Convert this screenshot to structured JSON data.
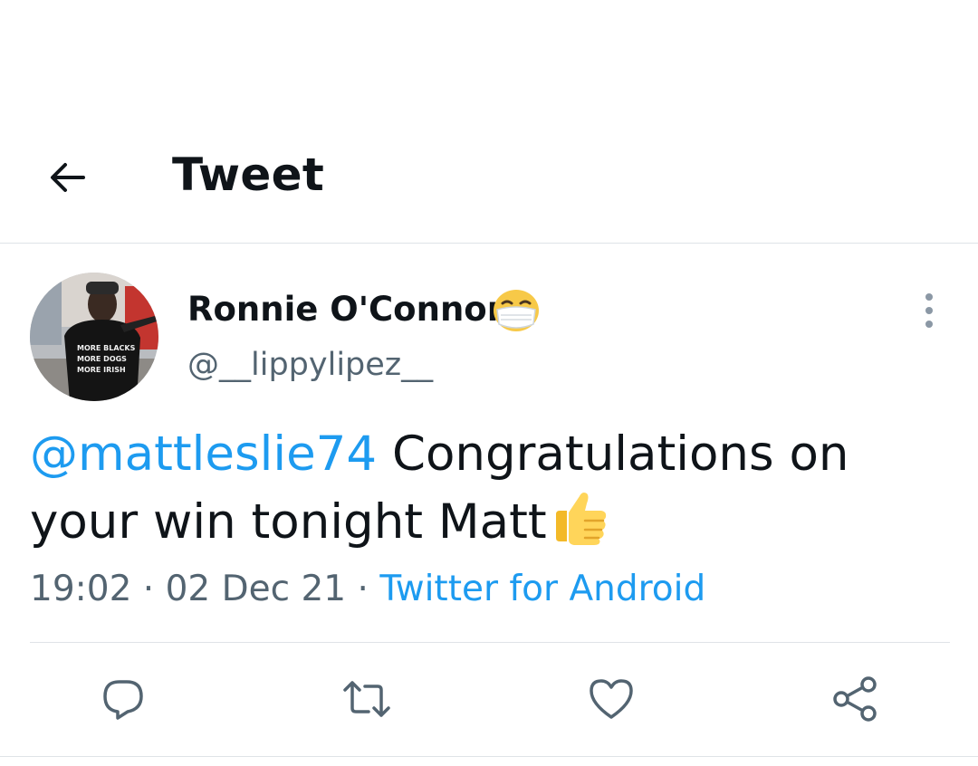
{
  "header": {
    "title": "Tweet",
    "back_icon": "arrow-left-icon"
  },
  "tweet": {
    "author": {
      "display_name": "Ronnie O'Connor",
      "name_emoji_icon": "face-with-medical-mask-icon",
      "handle": "@__lippylipez__",
      "avatar_icon": "user-avatar",
      "avatar_shirt_text": [
        "MORE BLACKS",
        "MORE DOGS",
        "MORE IRISH"
      ]
    },
    "mention": "@mattleslie74",
    "text_line1": " Congratulations on",
    "text_line2": "your win tonight Matt",
    "text_emoji_icon": "thumbs-up-icon",
    "time": "19:02",
    "separator": " · ",
    "date": "02 Dec 21",
    "source": "Twitter for Android"
  },
  "actions": [
    {
      "name": "reply",
      "icon": "reply-icon"
    },
    {
      "name": "retweet",
      "icon": "retweet-icon"
    },
    {
      "name": "like",
      "icon": "heart-icon"
    },
    {
      "name": "share",
      "icon": "share-icon"
    }
  ],
  "colors": {
    "accent": "#1d9bf0",
    "text": "#0f1419",
    "secondary_text": "#536471",
    "divider": "#dfe3e7",
    "icon": "#536471"
  }
}
